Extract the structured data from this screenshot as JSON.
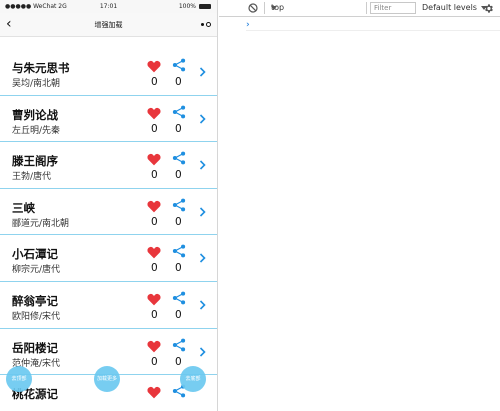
{
  "status_bar": {
    "carrier": "●●●●● WeChat 2G",
    "time": "17:01",
    "battery": "100%"
  },
  "nav": {
    "title": "增强加载"
  },
  "items": [
    {
      "title": "与朱元思书",
      "author": "吴均/南北朝",
      "likes": "0",
      "shares": "0"
    },
    {
      "title": "曹刿论战",
      "author": "左丘明/先秦",
      "likes": "0",
      "shares": "0"
    },
    {
      "title": "滕王阁序",
      "author": "王勃/唐代",
      "likes": "0",
      "shares": "0"
    },
    {
      "title": "三峡",
      "author": "郦道元/南北朝",
      "likes": "0",
      "shares": "0"
    },
    {
      "title": "小石潭记",
      "author": "柳宗元/唐代",
      "likes": "0",
      "shares": "0"
    },
    {
      "title": "醉翁亭记",
      "author": "欧阳修/宋代",
      "likes": "0",
      "shares": "0"
    },
    {
      "title": "岳阳楼记",
      "author": "范仲淹/宋代",
      "likes": "0",
      "shares": "0"
    },
    {
      "title": "桃花源记",
      "author": "",
      "likes": "",
      "shares": ""
    }
  ],
  "fabs": {
    "left": "去顶部",
    "center": "加载更多",
    "right": "去底部"
  },
  "console": {
    "context": "top",
    "filter_placeholder": "Filter",
    "levels": "Default levels",
    "prompt": "›"
  },
  "colors": {
    "heart": "#e8363c",
    "share": "#1f8fe0",
    "divider": "#8fd3ee",
    "fab": "#6cc9f0"
  }
}
